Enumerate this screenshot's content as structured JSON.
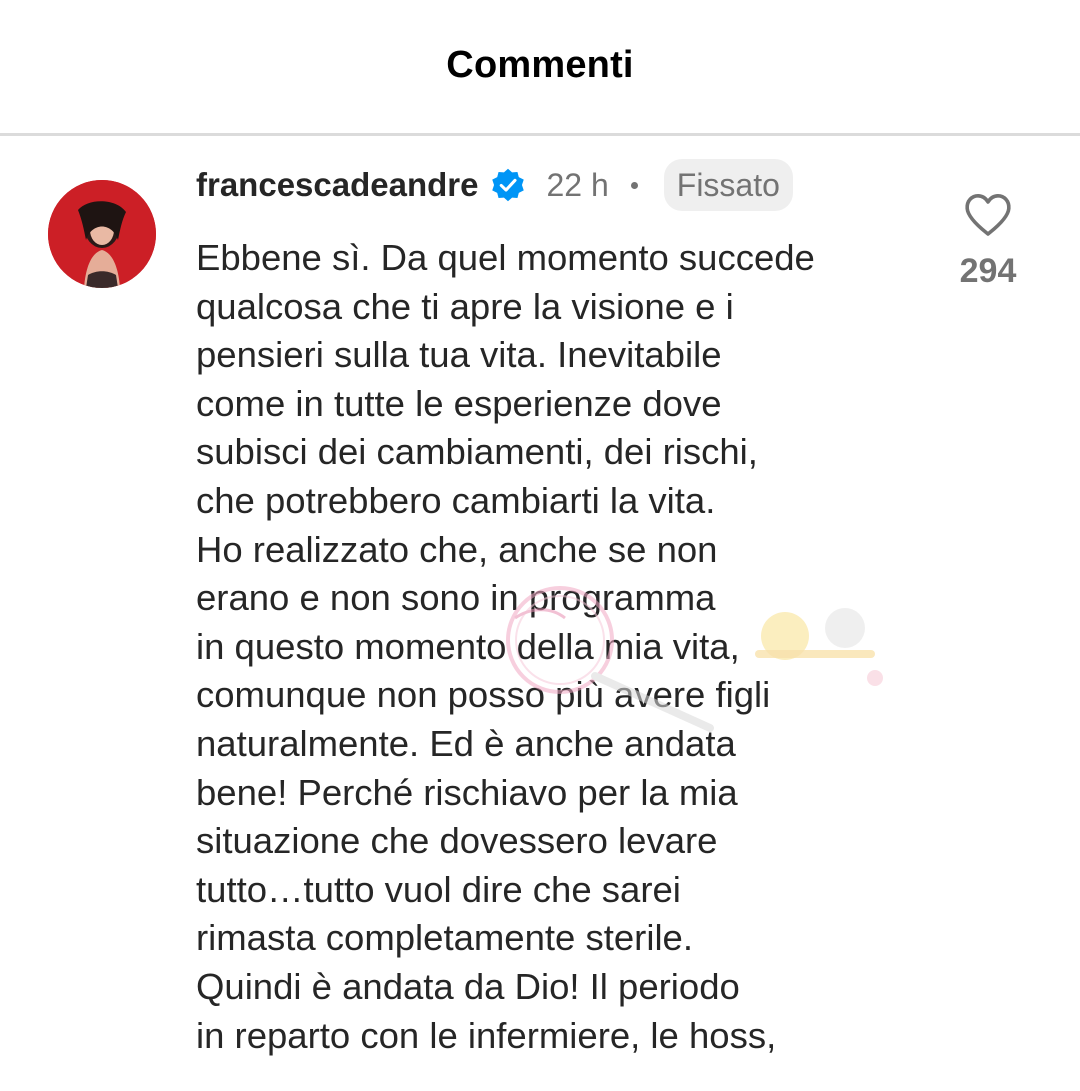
{
  "header": {
    "title": "Commenti"
  },
  "comment": {
    "username": "francescadeandre",
    "verified": true,
    "time": "22 h",
    "pinned_label": "Fissato",
    "lines": [
      "Ebbene sì. Da quel momento succede",
      "qualcosa che ti apre la visione e i",
      "pensieri sulla tua vita. Inevitabile",
      "come in tutte le esperienze dove",
      "subisci dei cambiamenti, dei rischi,",
      "che potrebbero cambiarti la vita.",
      "Ho realizzato che, anche se non",
      "erano e non sono in programma",
      "in questo momento della mia vita,",
      "comunque non posso più avere figli",
      "naturalmente. Ed è anche andata",
      "bene! Perché rischiavo per la mia",
      "situazione che dovessero levare",
      "tutto…tutto vuol dire che sarei",
      "rimasta completamente sterile.",
      "Quindi è andata da Dio! Il periodo",
      "in reparto con le infermiere, le hoss,"
    ],
    "like_count": "294"
  },
  "icons": {
    "verified": "verified-badge-icon",
    "like": "heart-outline-icon"
  },
  "colors": {
    "verified_blue": "#0095f6",
    "avatar_red": "#cf1f27",
    "secondary_text": "#737373",
    "pill_bg": "#efefef"
  }
}
